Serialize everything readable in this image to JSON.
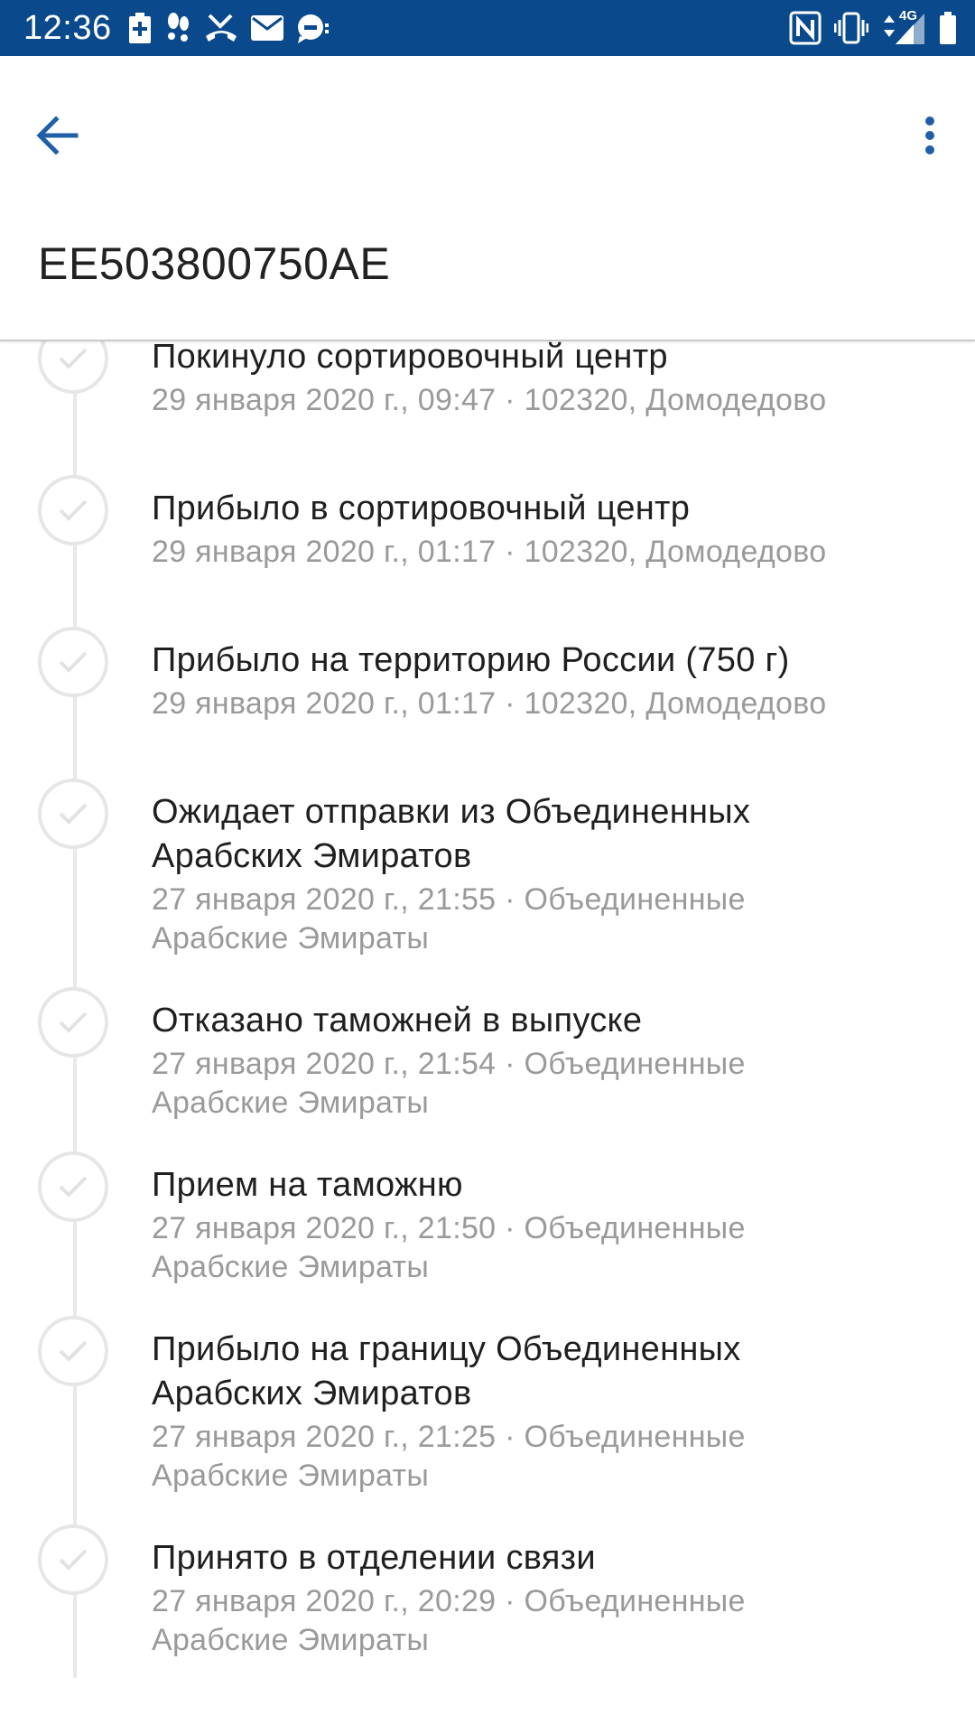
{
  "status_bar": {
    "time": "12:36",
    "network_label": "4G",
    "colors": {
      "background": "#0a4a8c",
      "foreground": "#ffffff"
    },
    "left_icons": [
      "battery-plus-icon",
      "footsteps-icon",
      "missed-call-icon",
      "mail-icon",
      "chat-bubble-icon"
    ],
    "right_icons": [
      "nfc-icon",
      "vibrate-icon",
      "signal-icon",
      "battery-icon"
    ]
  },
  "header": {
    "tracking_number": "EE503800750AE",
    "back_icon": "arrow-left-icon",
    "menu_icon": "more-vertical-icon",
    "accent_color": "#1f5fa8"
  },
  "events": [
    {
      "title": "Покинуло сортировочный центр",
      "meta": "29 января 2020 г., 09:47 · 102320, Домодедово"
    },
    {
      "title": "Прибыло в сортировочный центр",
      "meta": "29 января 2020 г., 01:17 · 102320, Домодедово"
    },
    {
      "title": "Прибыло на территорию России (750 г)",
      "meta": "29 января 2020 г., 01:17 · 102320, Домодедово"
    },
    {
      "title": "Ожидает отправки из Объединенных Арабских Эмиратов",
      "meta": "27 января 2020 г., 21:55 · Объединенные Арабские Эмираты"
    },
    {
      "title": "Отказано таможней в выпуске",
      "meta": "27 января 2020 г., 21:54 · Объединенные Арабские Эмираты"
    },
    {
      "title": "Прием на таможню",
      "meta": "27 января 2020 г., 21:50 · Объединенные Арабские Эмираты"
    },
    {
      "title": "Прибыло на границу Объединенных Арабских Эмиратов",
      "meta": "27 января 2020 г., 21:25 · Объединенные Арабские Эмираты"
    },
    {
      "title": "Принято в отделении связи",
      "meta": "27 января 2020 г., 20:29 · Объединенные Арабские Эмираты"
    }
  ]
}
